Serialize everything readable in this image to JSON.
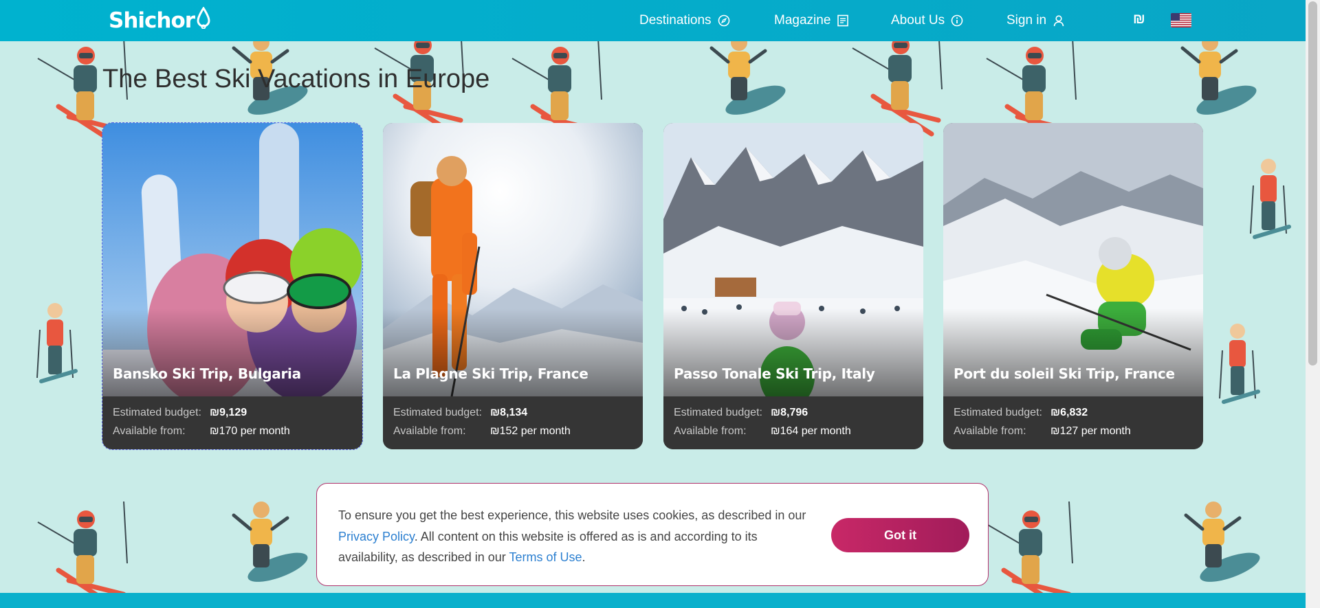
{
  "header": {
    "logo_text": "Shichor",
    "nav": [
      {
        "label": "Destinations",
        "icon": "compass-icon"
      },
      {
        "label": "Magazine",
        "icon": "document-icon"
      },
      {
        "label": "About Us",
        "icon": "info-icon"
      },
      {
        "label": "Sign in",
        "icon": "user-icon"
      }
    ],
    "currency_symbol": "₪",
    "language_flag": "us-flag-icon"
  },
  "page": {
    "title": "The Best Ski Vacations in Europe"
  },
  "cards": [
    {
      "title": "Bansko Ski Trip, Bulgaria",
      "budget_label": "Estimated budget:",
      "budget_value": "₪9,129",
      "available_label": "Available from:",
      "available_value": "₪170 per month"
    },
    {
      "title": "La Plagne Ski Trip, France",
      "budget_label": "Estimated budget:",
      "budget_value": "₪8,134",
      "available_label": "Available from:",
      "available_value": "₪152 per month"
    },
    {
      "title": "Passo Tonale Ski Trip, Italy",
      "budget_label": "Estimated budget:",
      "budget_value": "₪8,796",
      "available_label": "Available from:",
      "available_value": "₪164 per month"
    },
    {
      "title": "Port du soleil Ski Trip, France",
      "budget_label": "Estimated budget:",
      "budget_value": "₪6,832",
      "available_label": "Available from:",
      "available_value": "₪127 per month"
    }
  ],
  "cookie_banner": {
    "text_before": "To ensure you get the best experience, this website uses cookies, as described in our ",
    "privacy_link": "Privacy Policy",
    "text_middle": ". All content on this website is offered as is and according to its availability, as described in our ",
    "terms_link": "Terms of Use",
    "text_after": ".",
    "button_label": "Got it"
  },
  "colors": {
    "header": "#00b2cf",
    "background": "#c9ece8",
    "card_info": "#353535",
    "accent_button": "#b8235f",
    "link": "#2b7fd0"
  }
}
